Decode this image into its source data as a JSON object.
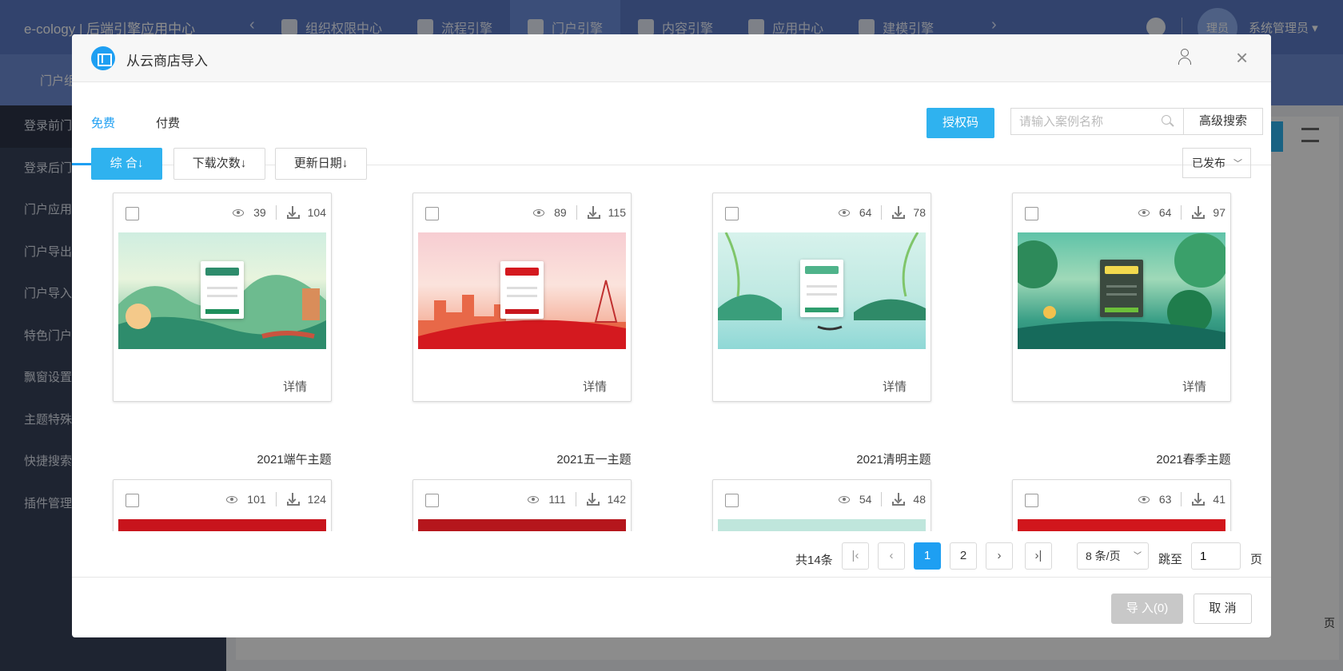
{
  "app": {
    "title": "e-cology | 后端引擎应用中心",
    "modules": [
      "组织权限中心",
      "流程引擎",
      "门户引擎",
      "内容引擎",
      "应用中心",
      "建模引擎"
    ],
    "active_module": "门户引擎",
    "avatar_text": "理员",
    "user_name": "系统管理员 ▾",
    "sub_label": "门户组",
    "sidebar": [
      "登录前门",
      "登录后门",
      "门户应用",
      "门户导出",
      "门户导入",
      "特色门户",
      "飘窗设置",
      "主题特殊",
      "快捷搜索",
      "插件管理"
    ],
    "bg_page_unit": "页"
  },
  "modal": {
    "title": "从云商店导入",
    "tabs": {
      "free": "免费",
      "paid": "付费"
    },
    "auth_button": "授权码",
    "search_placeholder": "请输入案例名称",
    "advanced_search": "高级搜索",
    "sort": {
      "composite": "综 合↓",
      "downloads": "下载次数↓",
      "updated": "更新日期↓"
    },
    "status_select": "已发布",
    "detail_label": "详情",
    "cards": [
      {
        "name": "2021端午主题",
        "views": "39",
        "downloads": "104"
      },
      {
        "name": "2021五一主题",
        "views": "89",
        "downloads": "115"
      },
      {
        "name": "2021清明主题",
        "views": "64",
        "downloads": "78"
      },
      {
        "name": "2021春季主题",
        "views": "64",
        "downloads": "97"
      },
      {
        "name": "",
        "views": "101",
        "downloads": "124"
      },
      {
        "name": "",
        "views": "111",
        "downloads": "142"
      },
      {
        "name": "",
        "views": "54",
        "downloads": "48"
      },
      {
        "name": "",
        "views": "63",
        "downloads": "41"
      }
    ],
    "pagination": {
      "total": "共14条",
      "pages": [
        "1",
        "2"
      ],
      "current": "1",
      "page_size": "8 条/页",
      "goto_label": "跳至",
      "goto_value": "1",
      "page_unit": "页"
    },
    "import_button": "导 入(0)",
    "cancel_button": "取 消"
  },
  "colors": {
    "primary": "#1e9ff2",
    "button_blue": "#2fb2ef",
    "disabled": "#c8c8c8"
  }
}
